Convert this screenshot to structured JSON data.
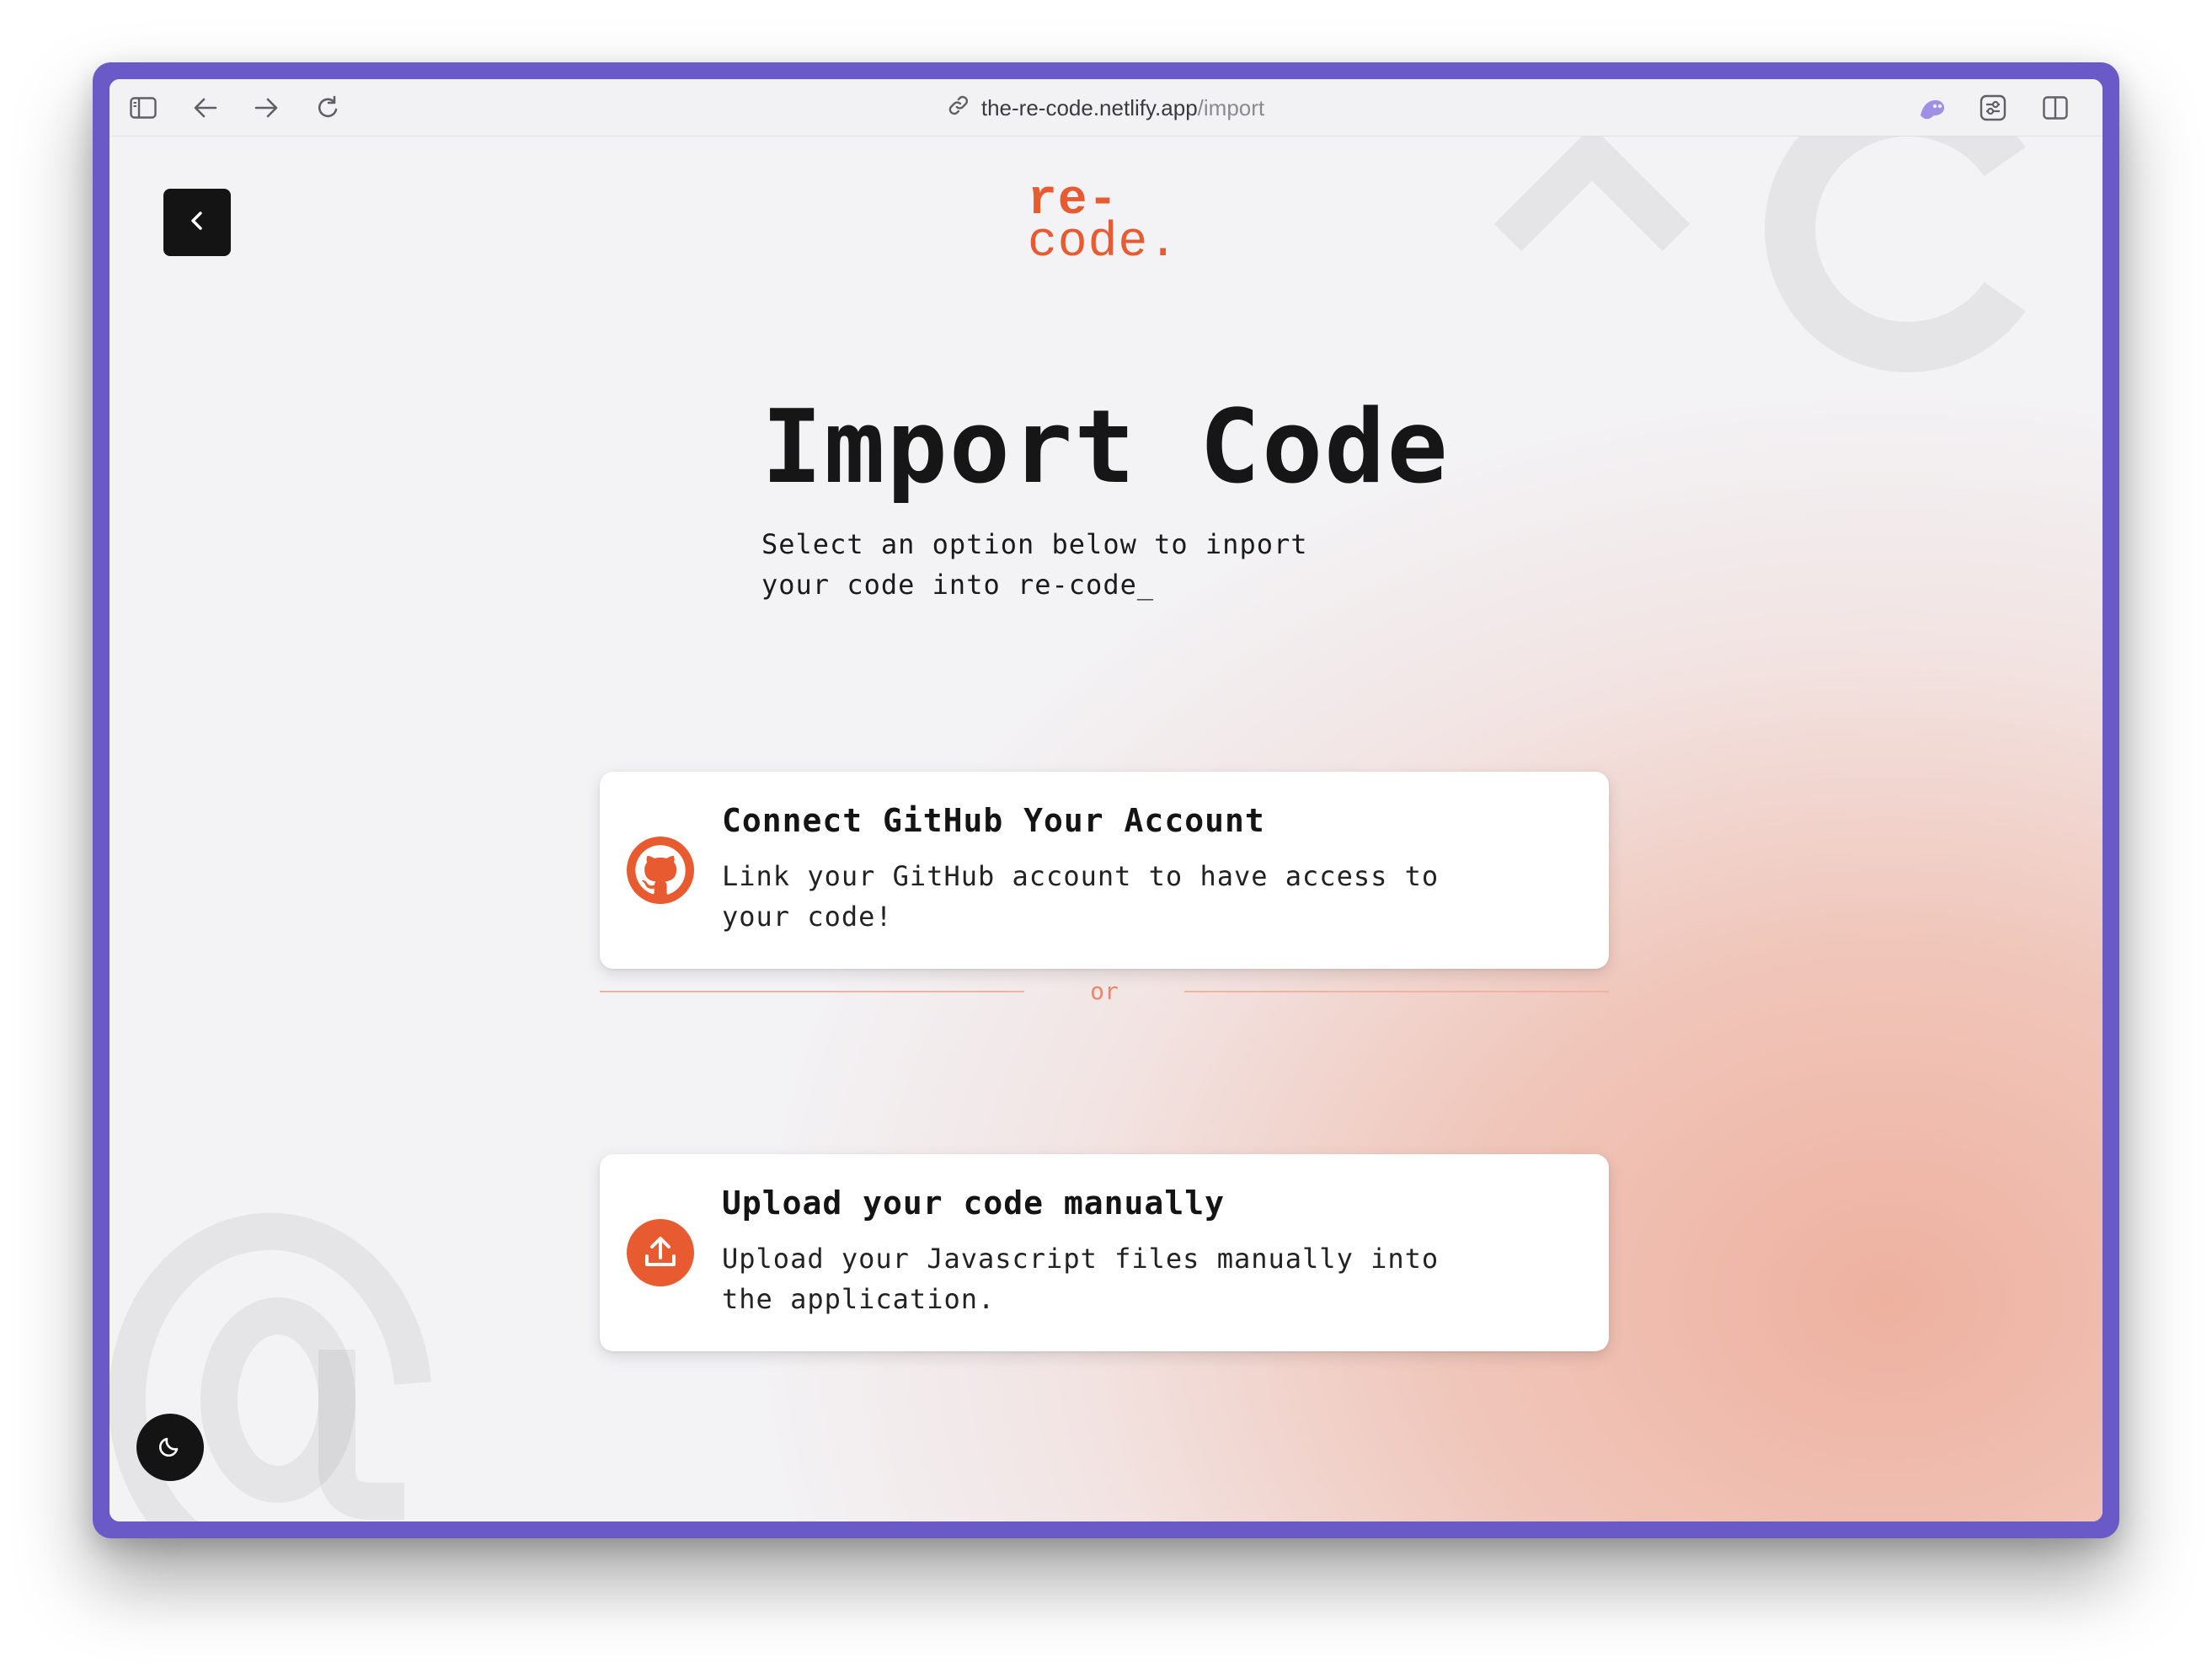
{
  "browser": {
    "url_domain": "the-re-code.netlify.app",
    "url_path": "/import",
    "icons": {
      "sidebar": "sidebar-icon",
      "back": "arrow-left-icon",
      "forward": "arrow-right-icon",
      "reload": "reload-icon",
      "link": "link-icon",
      "extension": "extension-icon",
      "settings": "sliders-icon",
      "split_view": "split-view-icon"
    }
  },
  "page": {
    "logo": {
      "line1": "re-",
      "line2": "code."
    },
    "title": "Import Code",
    "subtitle": "Select an option below to inport your code into re-code_",
    "options": [
      {
        "title": "Connect GitHub Your Account",
        "description": "Link your GitHub account to have access to your code!",
        "icon": "github-icon"
      },
      {
        "title": "Upload your code manually",
        "description": "Upload your Javascript files manually into the application.",
        "icon": "upload-icon"
      }
    ],
    "divider_text": "or",
    "colors": {
      "accent": "#e85a2f",
      "dark": "#141414",
      "window_frame": "#6a5ac8",
      "gradient_peach": "#eeb1a0"
    }
  }
}
